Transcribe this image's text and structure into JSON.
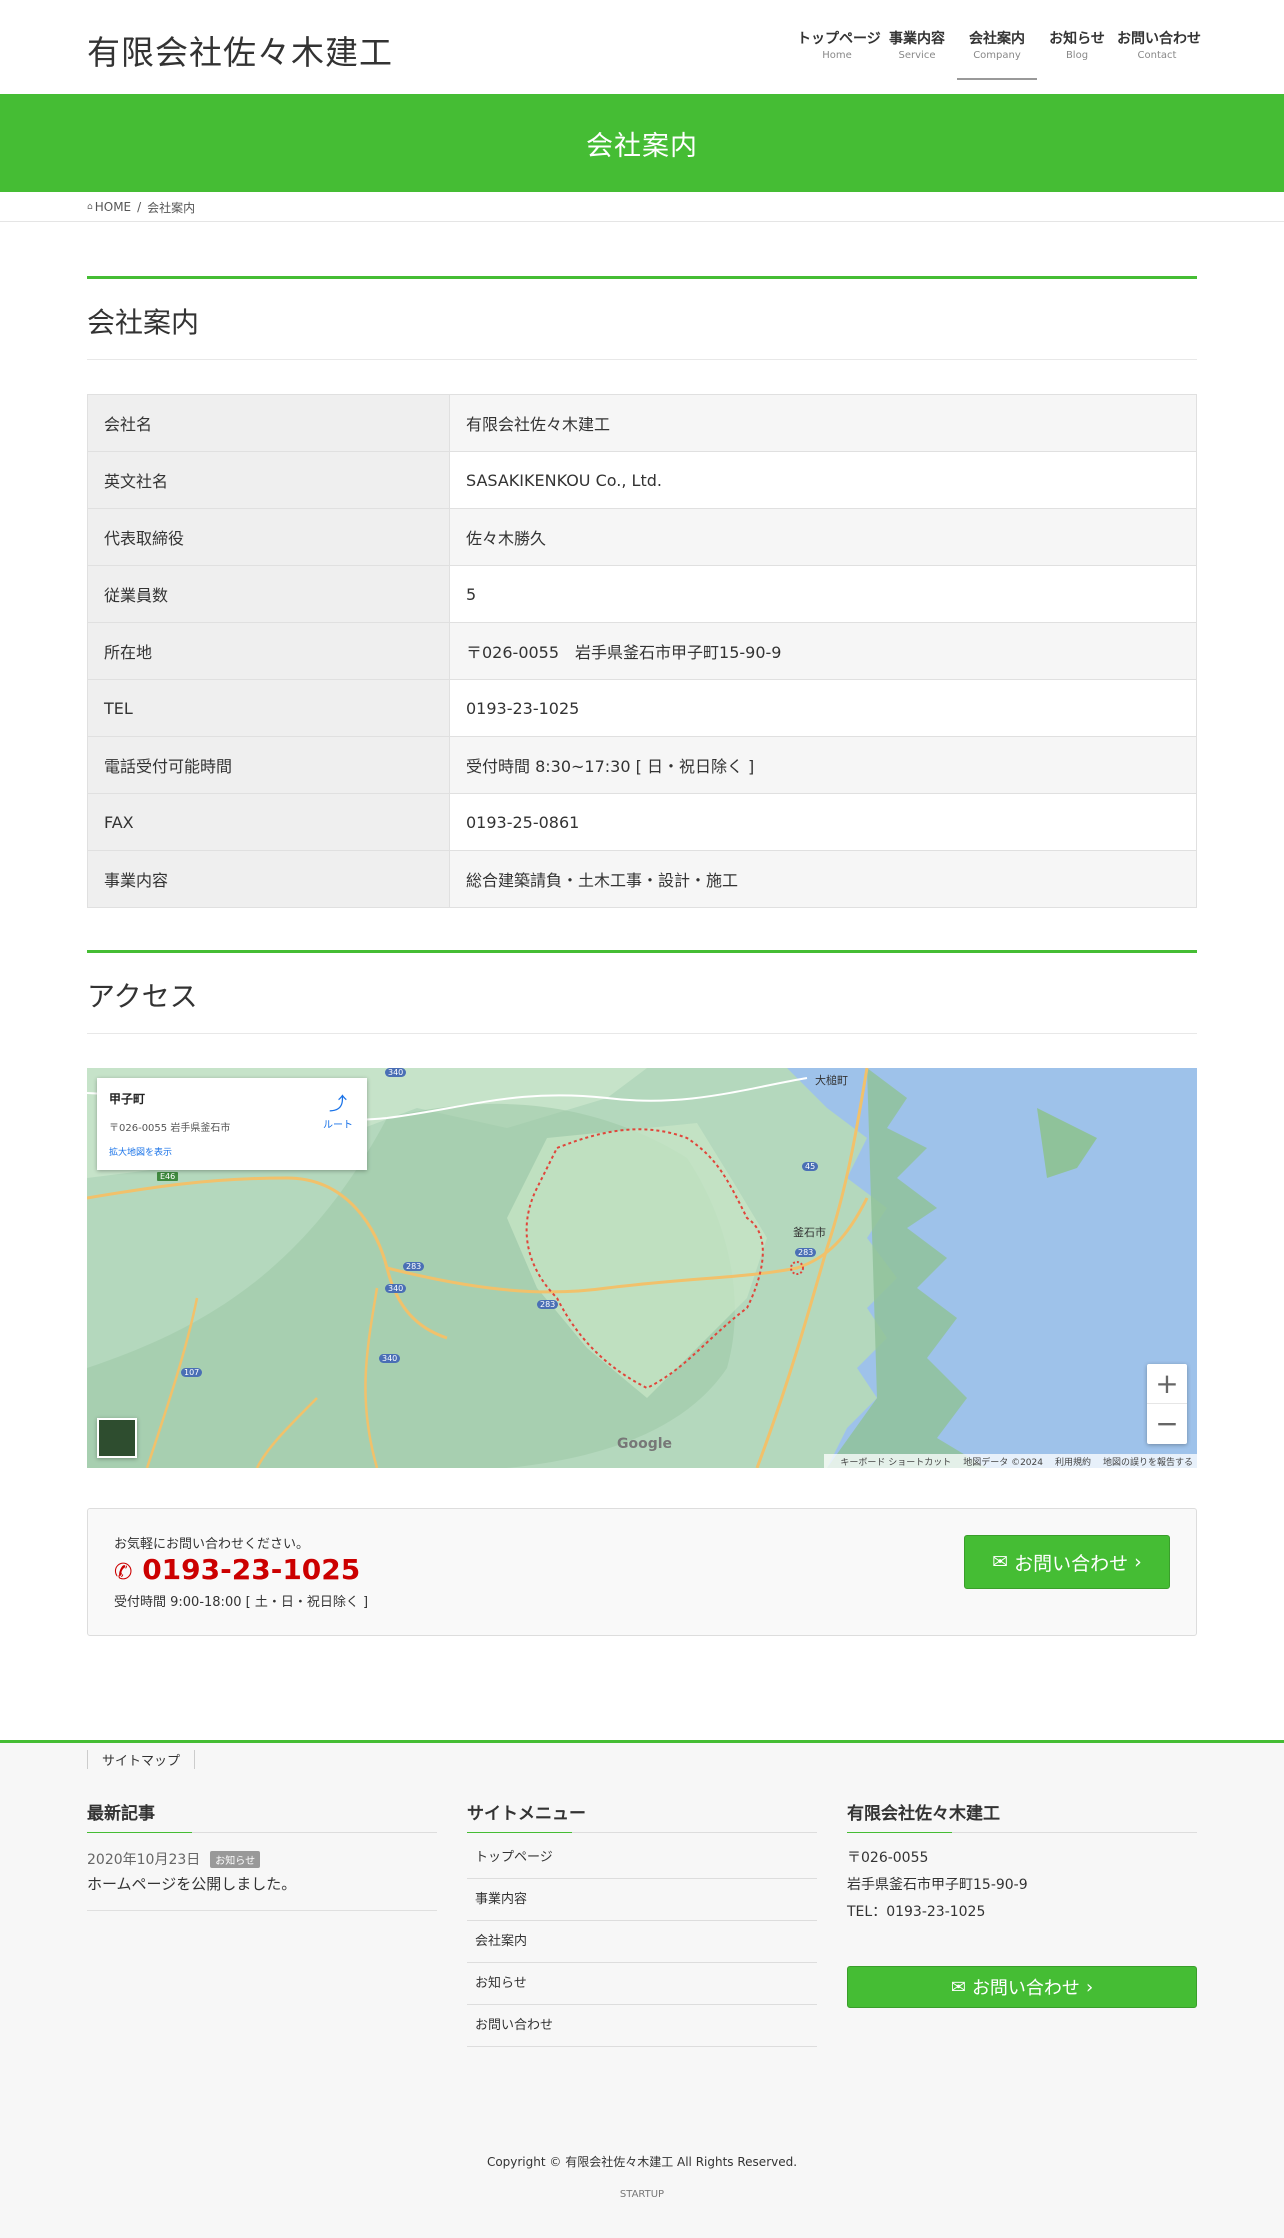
{
  "header": {
    "logo": "有限会社佐々木建工",
    "nav": [
      {
        "ja": "トップページ",
        "en": "Home"
      },
      {
        "ja": "事業内容",
        "en": "Service"
      },
      {
        "ja": "会社案内",
        "en": "Company"
      },
      {
        "ja": "お知らせ",
        "en": "Blog"
      },
      {
        "ja": "お問い合わせ",
        "en": "Contact"
      }
    ]
  },
  "page_title": "会社案内",
  "breadcrumb": {
    "home": "HOME",
    "current": "会社案内",
    "home_icon": "home-icon"
  },
  "company": {
    "heading": "会社案内",
    "rows": [
      {
        "label": "会社名",
        "value": "有限会社佐々木建工"
      },
      {
        "label": "英文社名",
        "value": "SASAKIKENKOU Co., Ltd."
      },
      {
        "label": "代表取締役",
        "value": "佐々木勝久"
      },
      {
        "label": "従業員数",
        "value": "5"
      },
      {
        "label": "所在地",
        "value": "〒026-0055　岩手県釜石市甲子町15-90-9"
      },
      {
        "label": "TEL",
        "value": "0193-23-1025"
      },
      {
        "label": "電話受付可能時間",
        "value": "受付時間 8:30~17:30 [ 日・祝日除く ]"
      },
      {
        "label": "FAX",
        "value": "0193-25-0861"
      },
      {
        "label": "事業内容",
        "value": "総合建築請負・土木工事・設計・施工"
      }
    ]
  },
  "access": {
    "heading": "アクセス",
    "map": {
      "card_name": "甲子町",
      "card_addr": "〒026-0055 岩手県釜石市",
      "card_link": "拡大地図を表示",
      "directions": "ルート",
      "labels": {
        "otsuchi": "大槌町",
        "kamaishi": "釜石市"
      },
      "road_badges": [
        "340",
        "E46",
        "45",
        "283",
        "340",
        "283",
        "340",
        "107",
        "283"
      ],
      "zoom_in": "+",
      "zoom_out": "−",
      "google": "Google",
      "attribution": [
        "キーボード ショートカット",
        "地図データ ©2024",
        "利用規約",
        "地図の誤りを報告する"
      ]
    }
  },
  "contact": {
    "lead": "お気軽にお問い合わせください。",
    "tel": "0193-23-1025",
    "hours": "受付時間 9:00-18:00 [ 土・日・祝日除く ]",
    "button": "お問い合わせ",
    "tel_icon": "phone-icon"
  },
  "footer": {
    "sitemap": "サイトマップ",
    "news": {
      "heading": "最新記事",
      "date": "2020年10月23日",
      "badge": "お知らせ",
      "title": "ホームページを公開しました。"
    },
    "menu": {
      "heading": "サイトメニュー",
      "items": [
        "トップページ",
        "事業内容",
        "会社案内",
        "お知らせ",
        "お問い合わせ"
      ]
    },
    "company": {
      "heading": "有限会社佐々木建工",
      "zip": "〒026-0055",
      "address": "岩手県釜石市甲子町15-90-9",
      "tel": "TEL：0193-23-1025",
      "button": "お問い合わせ"
    },
    "copyright": "Copyright © 有限会社佐々木建工 All Rights Reserved.",
    "powered": "STARTUP"
  }
}
